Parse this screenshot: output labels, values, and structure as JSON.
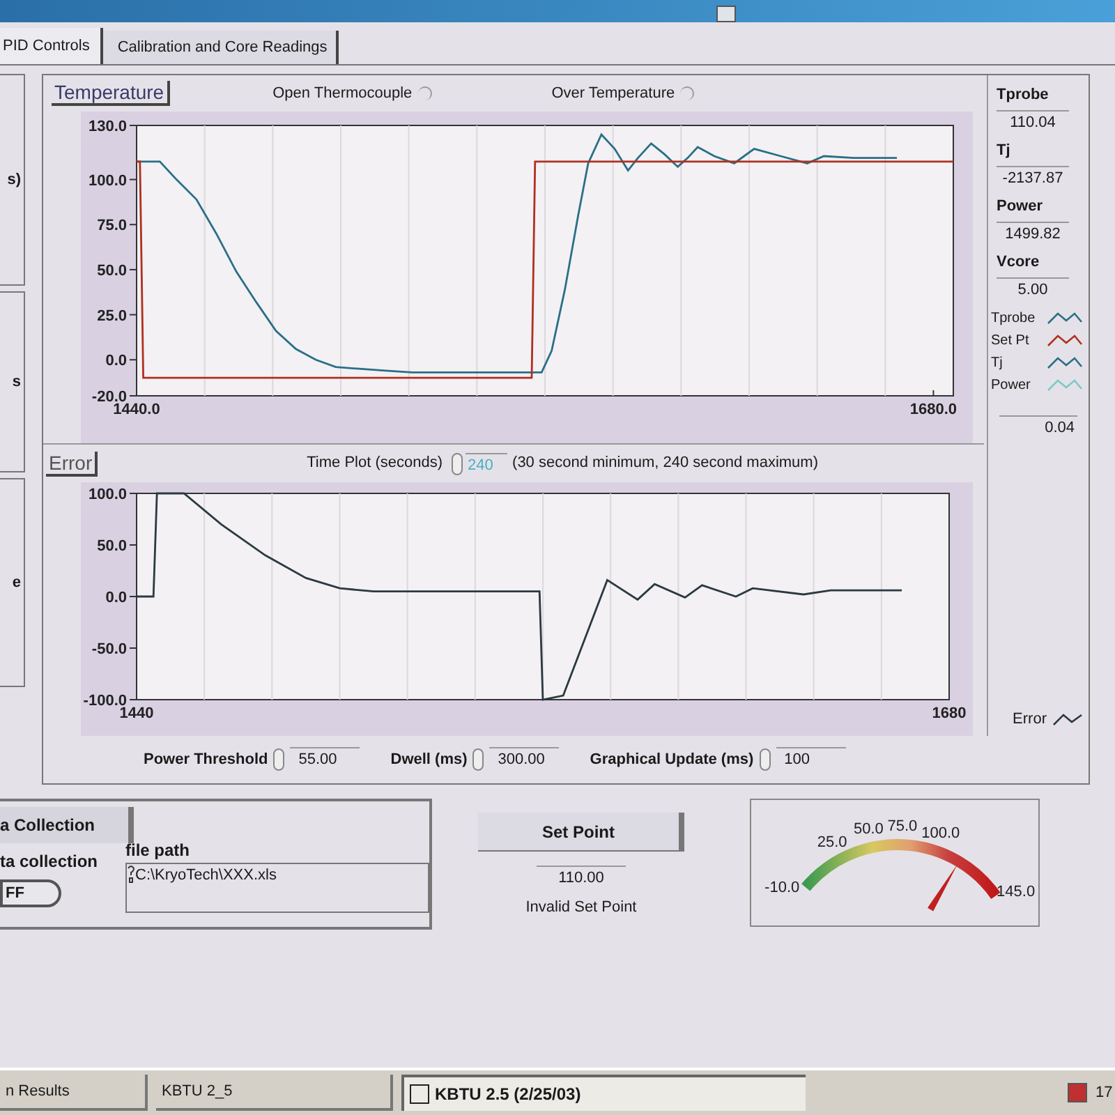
{
  "tabs": [
    {
      "label": "PID Controls",
      "selected": true
    },
    {
      "label": "Calibration and Core Readings",
      "selected": false
    }
  ],
  "left_panel": {
    "texts": [
      "s)",
      "s",
      "e"
    ]
  },
  "temperature_panel": {
    "title": "Temperature",
    "indicators": [
      {
        "label": "Open Thermocouple",
        "on": false
      },
      {
        "label": "Over Temperature",
        "on": false
      }
    ],
    "chart_data": {
      "type": "line",
      "x": [
        1440,
        1441,
        1442,
        1447,
        1452,
        1458,
        1464,
        1470,
        1476,
        1482,
        1488,
        1494,
        1500,
        1507,
        1515,
        1523,
        1540,
        1559,
        1560,
        1562,
        1565,
        1569,
        1573,
        1576,
        1580,
        1584,
        1588,
        1591,
        1595,
        1599,
        1603,
        1606,
        1609,
        1614,
        1620,
        1623,
        1626,
        1634,
        1642,
        1647,
        1656,
        1669,
        1686
      ],
      "series": [
        {
          "color": "#2a6f86",
          "values": [
            110,
            110,
            110,
            110,
            100,
            89,
            70,
            49,
            32,
            16,
            6,
            0,
            -4,
            -5,
            -6,
            -7,
            -7,
            -7,
            -7,
            -7,
            5,
            39,
            80,
            109,
            125,
            117,
            105,
            112,
            120,
            114,
            107,
            112,
            118,
            113,
            109,
            113,
            117,
            113,
            109,
            113,
            112,
            112,
            null
          ]
        },
        {
          "color": "#b03020",
          "values": [
            110,
            110,
            -10,
            -10,
            -10,
            -10,
            -10,
            -10,
            -10,
            -10,
            -10,
            -10,
            -10,
            -10,
            -10,
            -10,
            -10,
            -10,
            110,
            110,
            110,
            110,
            110,
            110,
            110,
            110,
            110,
            110,
            110,
            110,
            110,
            110,
            110,
            110,
            110,
            110,
            110,
            110,
            110,
            110,
            110,
            110,
            110
          ]
        }
      ],
      "xlim": [
        1440,
        1686
      ],
      "ylim": [
        -20,
        130
      ],
      "xticks": [
        {
          "value": 1440,
          "label": "1440.0"
        },
        {
          "value": 1680,
          "label": "1680.0"
        }
      ],
      "yticks": [
        {
          "value": 130,
          "label": "130.0"
        },
        {
          "value": 100,
          "label": "100.0"
        },
        {
          "value": 75,
          "label": "75.0"
        },
        {
          "value": 50,
          "label": "50.0"
        },
        {
          "value": 25,
          "label": "25.0"
        },
        {
          "value": 0,
          "label": "0.0"
        },
        {
          "value": -20,
          "label": "-20.0"
        }
      ]
    }
  },
  "readouts": [
    {
      "label": "Tprobe",
      "value": "110.04"
    },
    {
      "label": "Tj",
      "value": "-2137.87"
    },
    {
      "label": "Power",
      "value": "1499.82"
    },
    {
      "label": "Vcore",
      "value": "5.00"
    }
  ],
  "legend": [
    {
      "label": "Tprobe",
      "color": "#2a6f86"
    },
    {
      "label": "Set Pt",
      "color": "#b03020"
    },
    {
      "label": "Tj",
      "color": "#2a6f86"
    },
    {
      "label": "Power",
      "color": "#7fc8c8"
    }
  ],
  "error_panel": {
    "title": "Error",
    "time_plot": {
      "label": "Time Plot (seconds)",
      "value": "240",
      "disabled": true,
      "note": "(30 second minimum, 240 second maximum)"
    },
    "chart_data": {
      "type": "line",
      "x": [
        1440,
        1445,
        1446,
        1454,
        1465,
        1478,
        1490,
        1500,
        1510,
        1559,
        1560,
        1566,
        1579,
        1588,
        1593,
        1602,
        1607,
        1617,
        1622,
        1637,
        1645,
        1666
      ],
      "series": [
        {
          "color": "#2a3a40",
          "values": [
            0,
            0,
            100,
            100,
            70,
            40,
            18,
            8,
            5,
            5,
            -100,
            -96,
            16,
            -3,
            12,
            -1,
            11,
            0,
            8,
            2,
            6,
            6
          ]
        }
      ],
      "xlim": [
        1440,
        1680
      ],
      "ylim": [
        -100,
        100
      ],
      "xticks": [
        1440,
        1680
      ],
      "yticks": [
        {
          "value": 100,
          "label": "100.0"
        },
        {
          "value": 50,
          "label": "50.0"
        },
        {
          "value": 0,
          "label": "0.0"
        },
        {
          "value": -50,
          "label": "-50.0"
        },
        {
          "value": -100,
          "label": "-100.0"
        }
      ]
    },
    "value": "0.04",
    "legend_label": "Error"
  },
  "settings": [
    {
      "label": "Power Threshold",
      "value": "55.00"
    },
    {
      "label": "Dwell (ms)",
      "value": "300.00"
    },
    {
      "label": "Graphical Update (ms)",
      "value": "100"
    }
  ],
  "data_collection": {
    "button": "a Collection",
    "label": "ta collection",
    "switch": {
      "label": "FF",
      "on": false
    },
    "file_path": {
      "label": "file path",
      "value": "C:\\KryoTech\\XXX.xls"
    }
  },
  "set_point": {
    "button": "Set Point",
    "value": "110.00",
    "status": "Invalid Set Point"
  },
  "gauge": {
    "labels": [
      "-10.0",
      "25.0",
      "50.0",
      "75.0",
      "100.0",
      "145.0"
    ],
    "level": 0.77
  },
  "taskbar": {
    "items": [
      {
        "label": "n Results",
        "selected": false
      },
      {
        "label": "KBTU 2_5",
        "selected": false
      },
      {
        "label": "KBTU 2.5 (2/25/03)",
        "selected": true
      }
    ],
    "clock": "17"
  }
}
